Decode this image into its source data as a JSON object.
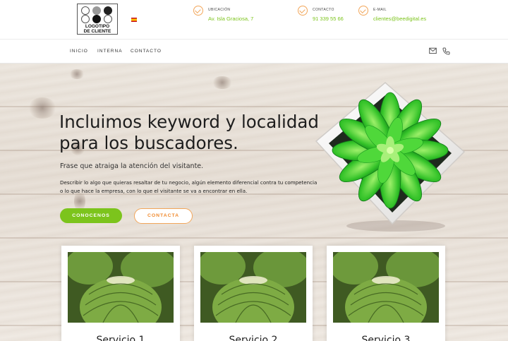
{
  "header": {
    "logo": {
      "line1": "LOGOTIPO",
      "line2": "DE CLIENTE"
    },
    "language_flag": "es-flag",
    "contacts": [
      {
        "icon": "check-circle-icon",
        "label": "UBICACIÓN",
        "value": "Av. Isla Graciosa, 7"
      },
      {
        "icon": "check-circle-icon",
        "label": "CONTACTO",
        "value": "91 339 55 66"
      },
      {
        "icon": "check-circle-icon",
        "label": "E-MAIL",
        "value": "clientes@beedigital.es"
      }
    ],
    "accent_green": "#7cc41c",
    "accent_orange": "#f2a65a"
  },
  "nav": {
    "items": [
      "INICIO",
      "INTERNA",
      "CONTACTO"
    ],
    "icons": [
      "envelope-icon",
      "phone-icon"
    ]
  },
  "hero": {
    "headline": "Incluimos keyword y localidad para los buscadores.",
    "subline": "Frase que atraiga la atención del visitante.",
    "description": "Describir lo algo que quieras resaltar de tu negocio, algún elemento diferencial contra tu competencia o lo que hace la empresa, con lo que el visitante se va a encontrar en ella.",
    "primary_button": "CONOCENOS",
    "secondary_button": "CONTACTA"
  },
  "services": [
    {
      "title": "Servicio 1"
    },
    {
      "title": "Servicio 2"
    },
    {
      "title": "Servicio 3"
    }
  ]
}
